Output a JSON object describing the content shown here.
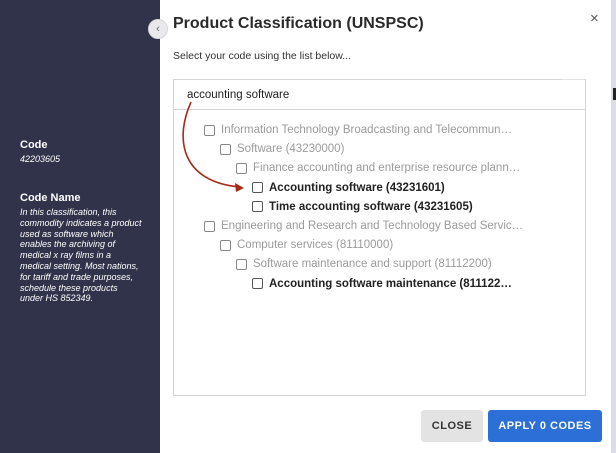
{
  "sidebar": {
    "code_label": "Code",
    "code_value": "42203605",
    "name_label": "Code Name",
    "name_value": "In this classification, this commodity indicates a product used as software which enables the archiving of medical x ray films in a medical setting. Most nations, for tariff and trade purposes, schedule these products under HS 852349."
  },
  "modal": {
    "title": "Product Classification (UNSPSC)",
    "subtitle": "Select your code using the list below...",
    "search_value": "accounting software",
    "close_icon": "×",
    "collapse_icon": "‹"
  },
  "tree": [
    {
      "label": "Information Technology Broadcasting and Telecommun…",
      "level": 0,
      "match": false
    },
    {
      "label": "Software (43230000)",
      "level": 1,
      "match": false
    },
    {
      "label": "Finance accounting and enterprise resource plann…",
      "level": 2,
      "match": false
    },
    {
      "label": "Accounting software (43231601)",
      "level": 3,
      "match": true
    },
    {
      "label": "Time accounting software (43231605)",
      "level": 3,
      "match": true
    },
    {
      "label": "Engineering and Research and Technology Based Servic…",
      "level": 0,
      "match": false
    },
    {
      "label": "Computer services (81110000)",
      "level": 1,
      "match": false
    },
    {
      "label": "Software maintenance and support (81112200)",
      "level": 2,
      "match": false
    },
    {
      "label": "Accounting software maintenance (811122…",
      "level": 3,
      "match": true
    }
  ],
  "buttons": {
    "close": "CLOSE",
    "apply": "APPLY 0 CODES"
  },
  "colors": {
    "sidebar_bg": "#30334a",
    "apply_bg": "#2c6fd6",
    "arrow": "#a52a1a"
  }
}
